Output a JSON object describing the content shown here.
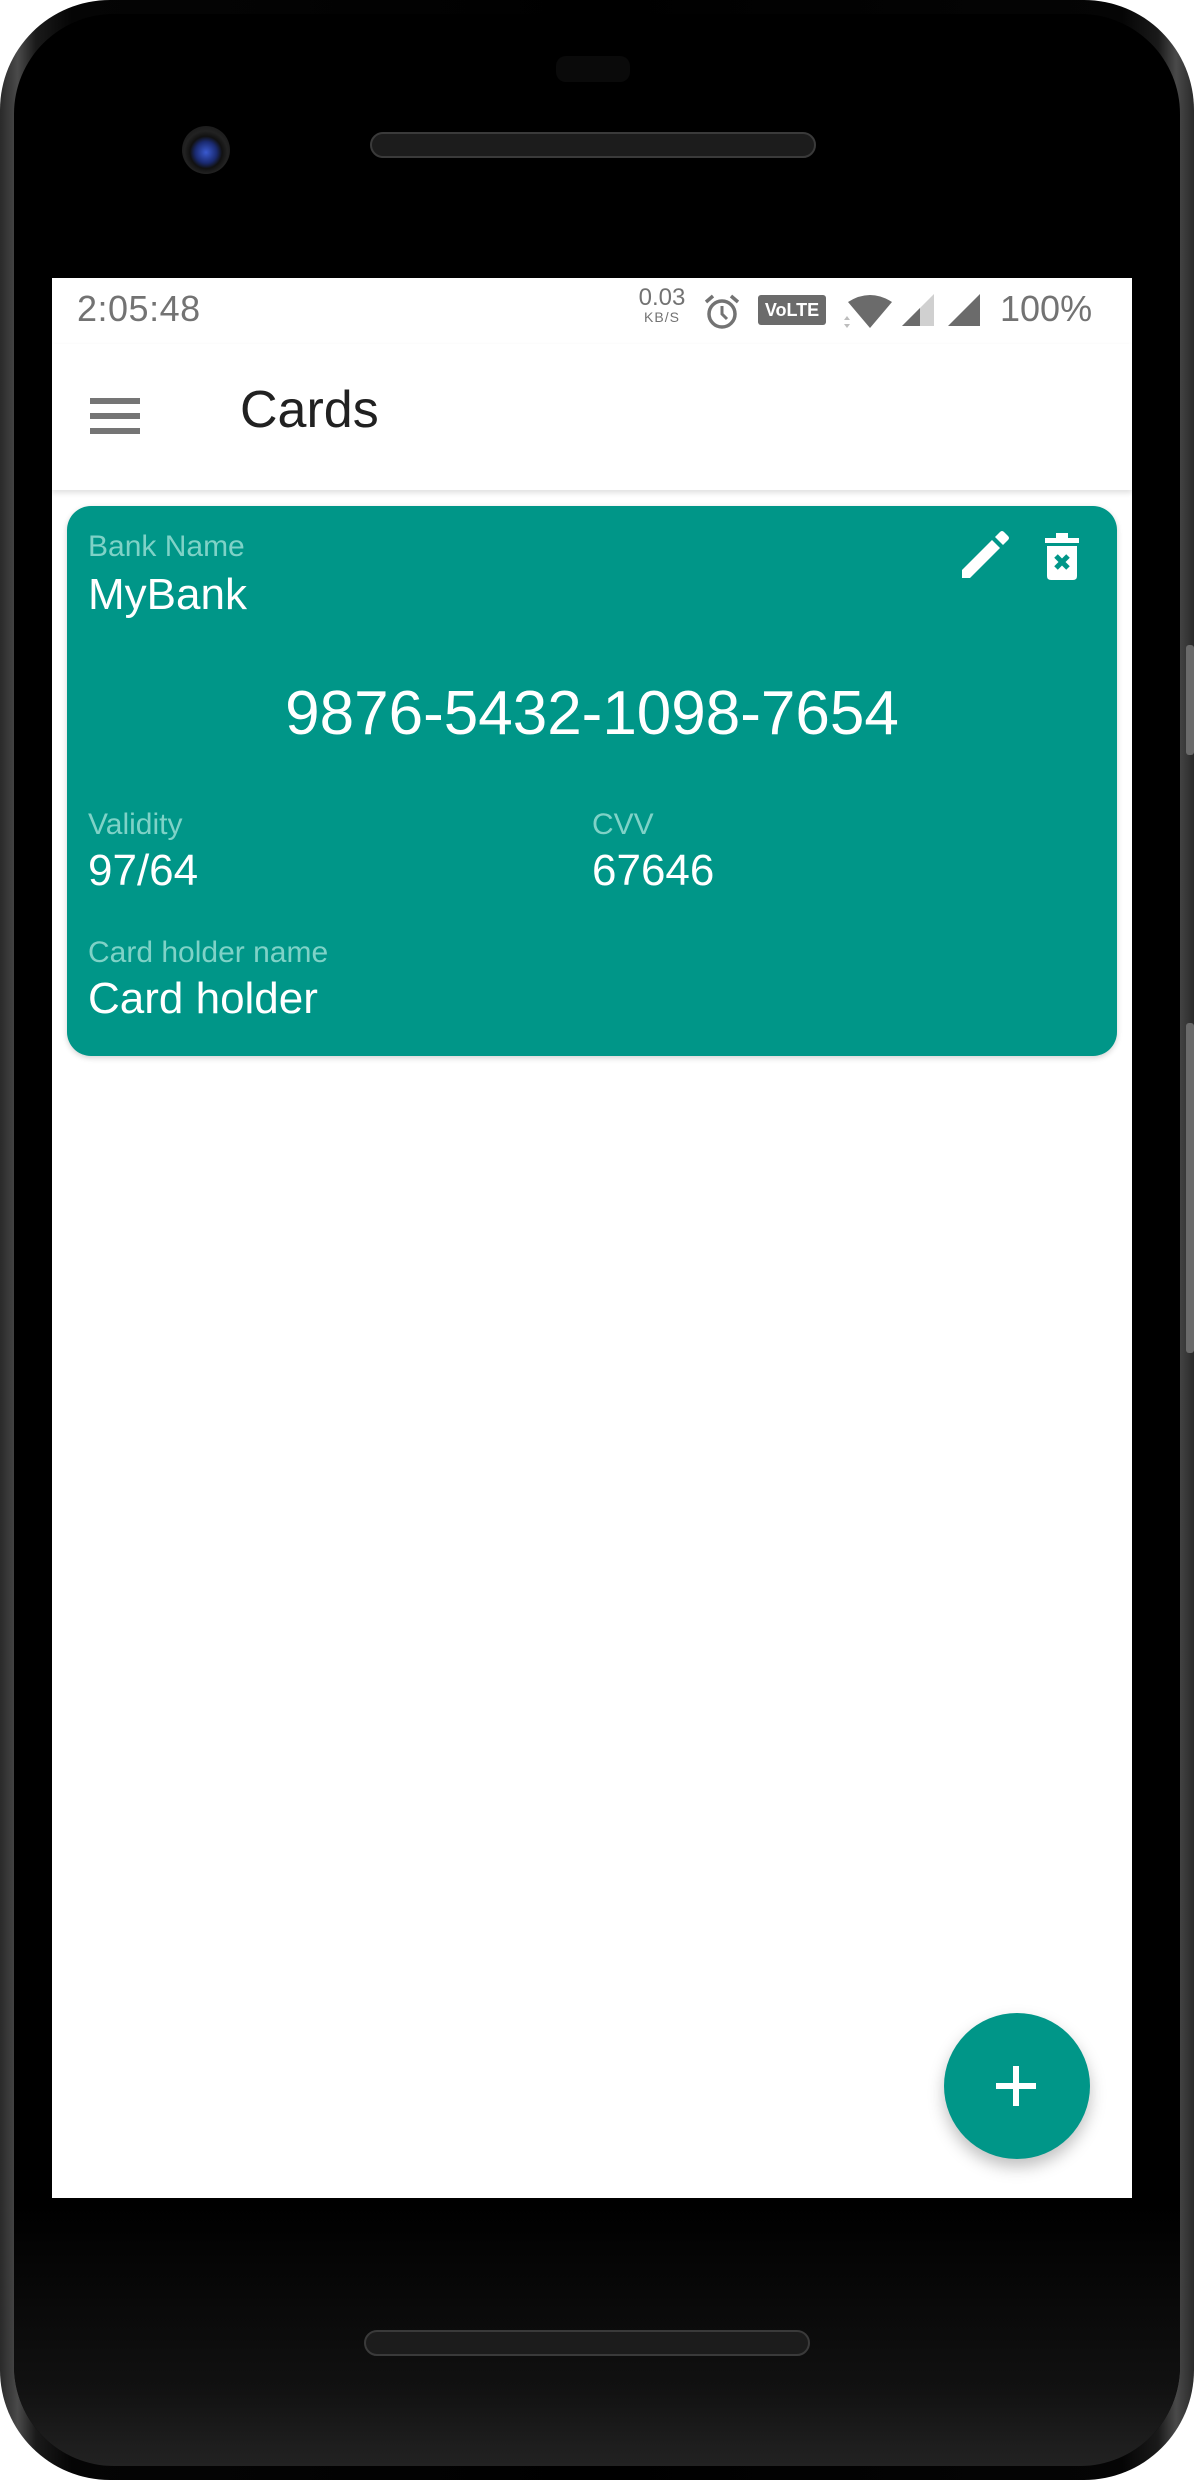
{
  "status_bar": {
    "time": "2:05:48",
    "net_speed_value": "0.03",
    "net_speed_unit": "KB/S",
    "volte_label": "VoLTE",
    "battery": "100%",
    "icons": [
      "alarm-icon",
      "volte-icon",
      "wifi-icon",
      "signal-sim1-icon",
      "signal-sim2-icon"
    ]
  },
  "toolbar": {
    "menu_icon": "hamburger-menu-icon",
    "title": "Cards"
  },
  "cards": [
    {
      "bank_name_label": "Bank Name",
      "bank_name": "MyBank",
      "card_number": "9876-5432-1098-7654",
      "validity_label": "Validity",
      "validity": "97/64",
      "cvv_label": "CVV",
      "cvv": "67646",
      "holder_label": "Card holder name",
      "holder": "Card holder",
      "actions": [
        "edit-icon",
        "delete-icon"
      ]
    }
  ],
  "fab": {
    "icon": "plus-icon",
    "action": "add-card"
  },
  "colors": {
    "accent": "#009688",
    "card_label": "#7fd2c7",
    "toolbar_title": "#212121",
    "status_text": "#737373"
  }
}
